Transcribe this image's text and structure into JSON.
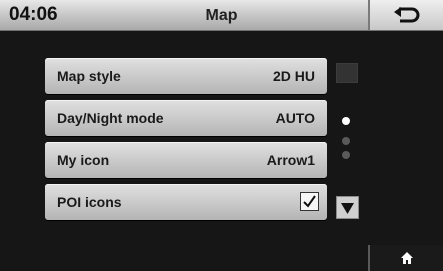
{
  "status": {
    "time": "04:06",
    "title": "Map"
  },
  "menu": {
    "items": [
      {
        "label": "Map style",
        "value": "2D HU"
      },
      {
        "label": "Day/Night mode",
        "value": "AUTO"
      },
      {
        "label": "My icon",
        "value": "Arrow1"
      },
      {
        "label": "POI icons",
        "value": "",
        "checked": true
      }
    ]
  },
  "page_indicator": {
    "total": 3,
    "current": 1
  },
  "icons": {
    "back": "back-arrow-icon",
    "home": "home-icon",
    "up": "scroll-up-icon",
    "down": "scroll-down-icon"
  }
}
